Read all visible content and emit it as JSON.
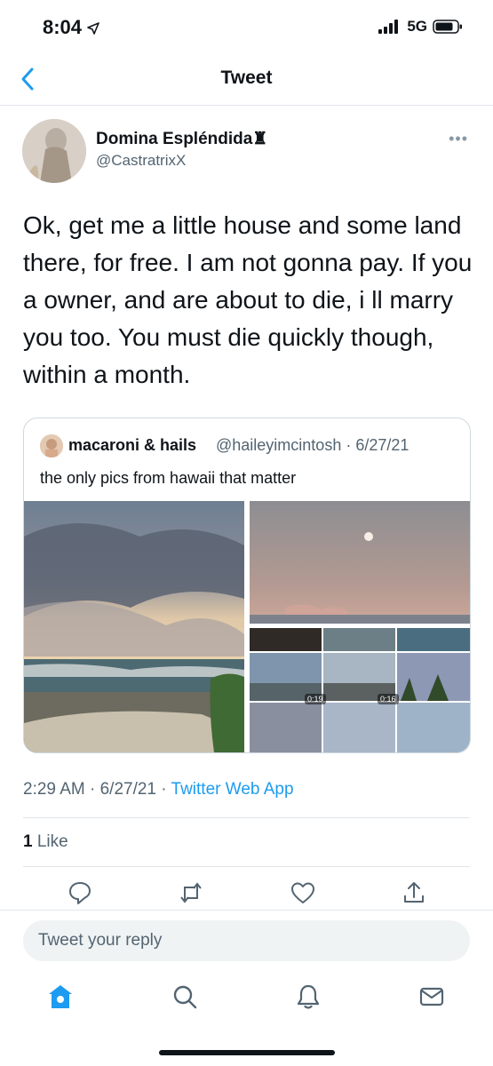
{
  "status": {
    "time": "8:04",
    "network": "5G"
  },
  "header": {
    "title": "Tweet"
  },
  "tweet": {
    "author_name": "Domina Espléndida♜",
    "author_handle": "@CastratrixX",
    "text": "Ok, get me a little house and some land there, for free. I am not gonna pay. If you a owner, and are about to die, i ll marry you too. You must die quickly though, within a month.",
    "timestamp": "2:29 AM · 6/27/21 · ",
    "source": "Twitter Web App",
    "like_count": "1",
    "like_label": " Like"
  },
  "quote": {
    "author_name": "macaroni & hails",
    "author_handle": "@haileyimcintosh · 6/27/21",
    "text": "the only pics from hawaii that matter",
    "video_durations": [
      "0:19",
      "0:16"
    ]
  },
  "reply": {
    "placeholder": "Tweet your reply"
  },
  "colors": {
    "accent": "#1d9bf0",
    "secondary_text": "#536471"
  },
  "icons": [
    "back-chevron-icon",
    "location-arrow-icon",
    "signal-icon",
    "battery-icon",
    "more-icon",
    "reply-icon",
    "retweet-icon",
    "like-icon",
    "share-icon",
    "home-icon",
    "search-icon",
    "notifications-icon",
    "messages-icon"
  ]
}
